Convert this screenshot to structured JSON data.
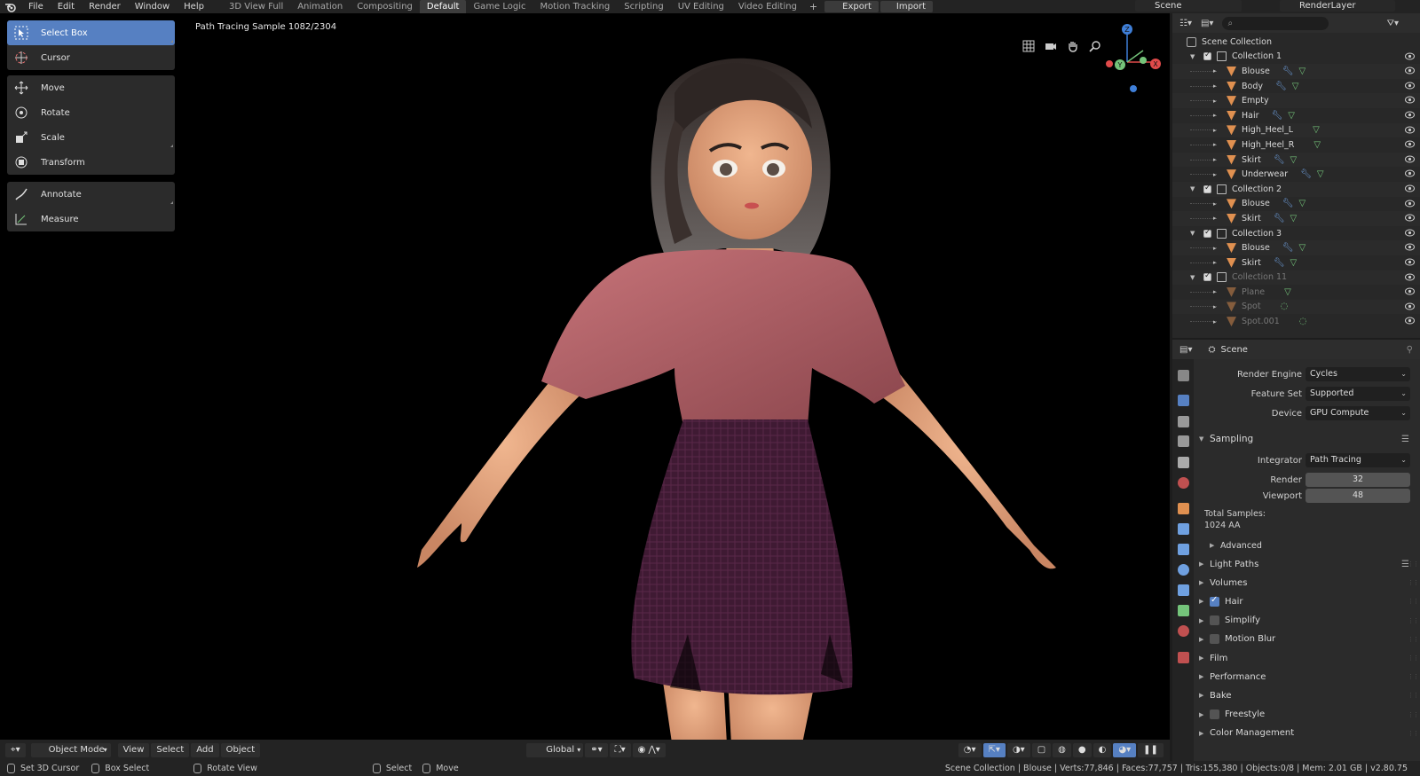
{
  "menu": [
    "File",
    "Edit",
    "Render",
    "Window",
    "Help"
  ],
  "workspace_tabs": [
    {
      "label": "3D View Full"
    },
    {
      "label": "Animation"
    },
    {
      "label": "Compositing"
    },
    {
      "label": "Default"
    },
    {
      "label": "Game Logic"
    },
    {
      "label": "Motion Tracking"
    },
    {
      "label": "Scripting"
    },
    {
      "label": "UV Editing"
    },
    {
      "label": "Video Editing"
    }
  ],
  "active_tab": "Default",
  "topbar": {
    "add": "+",
    "export": "Export",
    "import": "Import",
    "scene": "Scene",
    "render_layer": "RenderLayer"
  },
  "viewport": {
    "status": "Path Tracing Sample 1082/2304",
    "tools_group1": [
      "Select Box",
      "Cursor"
    ],
    "tools_group2": [
      "Move",
      "Rotate",
      "Scale",
      "Transform"
    ],
    "tools_group3": [
      "Annotate",
      "Measure"
    ],
    "gizmo": {
      "z": "Z",
      "y": "Y",
      "x": "X"
    },
    "footer": {
      "mode": "Object Mode",
      "view": "View",
      "select": "Select",
      "add": "Add",
      "object": "Object",
      "orientation": "Global"
    }
  },
  "outliner": {
    "root": "Scene Collection",
    "rows": [
      {
        "label": "Collection 1",
        "kind": "collection",
        "depth": 0
      },
      {
        "label": "Blouse",
        "kind": "mesh-mod",
        "depth": 1
      },
      {
        "label": "Body",
        "kind": "mesh-mod",
        "depth": 1
      },
      {
        "label": "Empty",
        "kind": "empty",
        "depth": 1
      },
      {
        "label": "Hair",
        "kind": "mesh-mod",
        "depth": 1
      },
      {
        "label": "High_Heel_L",
        "kind": "mesh",
        "depth": 1
      },
      {
        "label": "High_Heel_R",
        "kind": "mesh",
        "depth": 1
      },
      {
        "label": "Skirt",
        "kind": "mesh-mod",
        "depth": 1
      },
      {
        "label": "Underwear",
        "kind": "mesh-mod",
        "depth": 1
      },
      {
        "label": "Collection 2",
        "kind": "collection",
        "depth": 0
      },
      {
        "label": "Blouse",
        "kind": "mesh-mod",
        "depth": 1
      },
      {
        "label": "Skirt",
        "kind": "mesh-mod",
        "depth": 1
      },
      {
        "label": "Collection 3",
        "kind": "collection",
        "depth": 0
      },
      {
        "label": "Blouse",
        "kind": "mesh-mod",
        "depth": 1
      },
      {
        "label": "Skirt",
        "kind": "mesh-mod",
        "depth": 1
      },
      {
        "label": "Collection 11",
        "kind": "collection-dim",
        "depth": 0
      },
      {
        "label": "Plane",
        "kind": "mesh-dim",
        "depth": 1
      },
      {
        "label": "Spot",
        "kind": "light-dim",
        "depth": 1
      },
      {
        "label": "Spot.001",
        "kind": "light-dim",
        "depth": 1
      }
    ]
  },
  "properties": {
    "header": "Scene",
    "render_engine_label": "Render Engine",
    "render_engine": "Cycles",
    "feature_set_label": "Feature Set",
    "feature_set": "Supported",
    "device_label": "Device",
    "device": "GPU Compute",
    "sampling": "Sampling",
    "integrator_label": "Integrator",
    "integrator": "Path Tracing",
    "render_label": "Render",
    "render": "32",
    "viewport_label": "Viewport",
    "viewport": "48",
    "total_samples_label": "Total Samples:",
    "total_samples": "1024 AA",
    "advanced": "Advanced",
    "sections": [
      {
        "label": "Light Paths",
        "checkbox": null
      },
      {
        "label": "Volumes",
        "checkbox": null
      },
      {
        "label": "Hair",
        "checkbox": true
      },
      {
        "label": "Simplify",
        "checkbox": false
      },
      {
        "label": "Motion Blur",
        "checkbox": false
      },
      {
        "label": "Film",
        "checkbox": null
      },
      {
        "label": "Performance",
        "checkbox": null
      },
      {
        "label": "Bake",
        "checkbox": null
      },
      {
        "label": "Freestyle",
        "checkbox": false
      },
      {
        "label": "Color Management",
        "checkbox": null
      }
    ]
  },
  "statusbar": {
    "set_cursor": "Set 3D Cursor",
    "box_select": "Box Select",
    "rotate_view": "Rotate View",
    "select": "Select",
    "move": "Move",
    "stats": "Scene Collection | Blouse | Verts:77,846 | Faces:77,757 | Tris:155,380 | Objects:0/8 | Mem: 2.01 GB | v2.80.75"
  },
  "colors": {
    "accent": "#5680c2",
    "mesh": "#74c47a",
    "modifier": "#6fa0e0",
    "object": "#e09050"
  }
}
